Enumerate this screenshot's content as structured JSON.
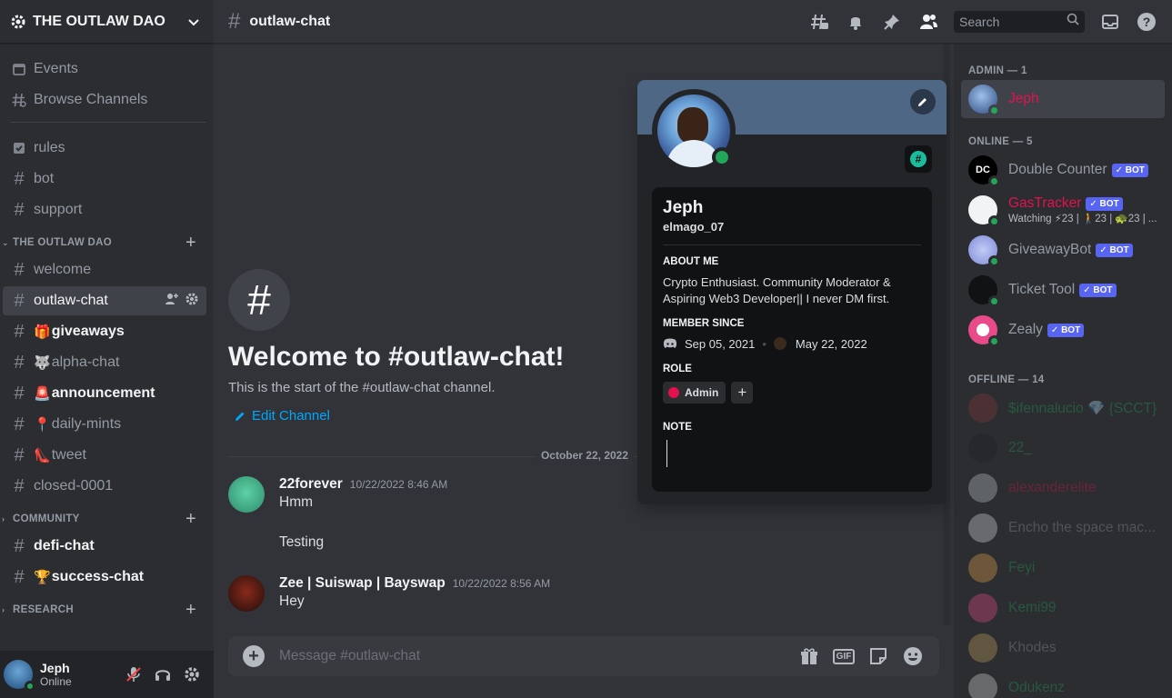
{
  "server": {
    "name": "THE OUTLAW DAO"
  },
  "sidebar": {
    "top": [
      {
        "label": "Events",
        "icon": "calendar-icon"
      },
      {
        "label": "Browse Channels",
        "icon": "browse-channels-icon"
      }
    ],
    "pinned": [
      {
        "label": "rules",
        "icon": "rules-checkbox-icon"
      },
      {
        "label": "bot",
        "icon": "hash"
      },
      {
        "label": "support",
        "icon": "hash"
      }
    ],
    "categories": [
      {
        "name": "THE OUTLAW DAO",
        "channels": [
          {
            "label": "welcome"
          },
          {
            "label": "outlaw-chat"
          },
          {
            "label": "giveaways",
            "emoji": "🎁"
          },
          {
            "label": "alpha-chat",
            "emoji": "🐺"
          },
          {
            "label": "announcement",
            "emoji": "🚨"
          },
          {
            "label": "daily-mints",
            "emoji": "📍"
          },
          {
            "label": "tweet",
            "emoji": "👠"
          },
          {
            "label": "closed-0001"
          }
        ]
      },
      {
        "name": "COMMUNITY",
        "channels": [
          {
            "label": "defi-chat"
          },
          {
            "label": "success-chat",
            "emoji": "🏆"
          }
        ]
      },
      {
        "name": "RESEARCH",
        "channels": []
      }
    ]
  },
  "user_panel": {
    "name": "Jeph",
    "status": "Online"
  },
  "header": {
    "channel": "outlaw-chat",
    "search_placeholder": "Search"
  },
  "welcome": {
    "title": "Welcome to #outlaw-chat!",
    "subtitle": "This is the start of the #outlaw-chat channel.",
    "edit_label": "Edit Channel"
  },
  "date_divider": "October 22, 2022",
  "messages": [
    {
      "author": "22forever",
      "time": "10/22/2022 8:46 AM",
      "lines": [
        "Hmm",
        "",
        "Testing"
      ]
    },
    {
      "author": "Zee | Suiswap | Bayswap",
      "time": "10/22/2022 8:56 AM",
      "lines": [
        "Hey"
      ]
    }
  ],
  "composer": {
    "placeholder": "Message #outlaw-chat"
  },
  "profile": {
    "name": "Jeph",
    "username": "elmago_07",
    "about_heading": "ABOUT ME",
    "about": "Crypto Enthusiast. Community Moderator & Aspiring Web3 Developer|| I never DM first.",
    "member_since_heading": "MEMBER SINCE",
    "discord_since": "Sep 05, 2021",
    "server_since": "May 22, 2022",
    "role_heading": "ROLE",
    "roles": [
      "Admin"
    ],
    "note_heading": "NOTE"
  },
  "members": {
    "admin_heading": "ADMIN — 1",
    "online_heading": "ONLINE — 5",
    "offline_heading": "OFFLINE — 14",
    "bot_label": "✓ BOT",
    "admin": [
      {
        "name": "Jeph",
        "color": "#e1124e"
      }
    ],
    "online": [
      {
        "name": "Double Counter",
        "bot": true,
        "color": "#949ba4"
      },
      {
        "name": "GasTracker",
        "bot": true,
        "color": "#e1124e",
        "activity": "Watching ⚡23 | 🚶23 | 🐢23 | ..."
      },
      {
        "name": "GiveawayBot",
        "bot": true,
        "color": "#949ba4"
      },
      {
        "name": "Ticket Tool",
        "bot": true,
        "color": "#949ba4"
      },
      {
        "name": "Zealy",
        "bot": true,
        "color": "#949ba4"
      }
    ],
    "offline": [
      {
        "name": "$ifennalucio 💎 {SCCT}",
        "color": "#23a55a"
      },
      {
        "name": "22_",
        "color": "#23a55a"
      },
      {
        "name": "alexanderelite",
        "color": "#e1124e"
      },
      {
        "name": "Encho the space mac...",
        "color": "#949ba4"
      },
      {
        "name": "Feyi",
        "color": "#23a55a"
      },
      {
        "name": "Kemi99",
        "color": "#23a55a"
      },
      {
        "name": "Khodes",
        "color": "#949ba4"
      },
      {
        "name": "Odukenz",
        "color": "#23a55a"
      }
    ]
  }
}
